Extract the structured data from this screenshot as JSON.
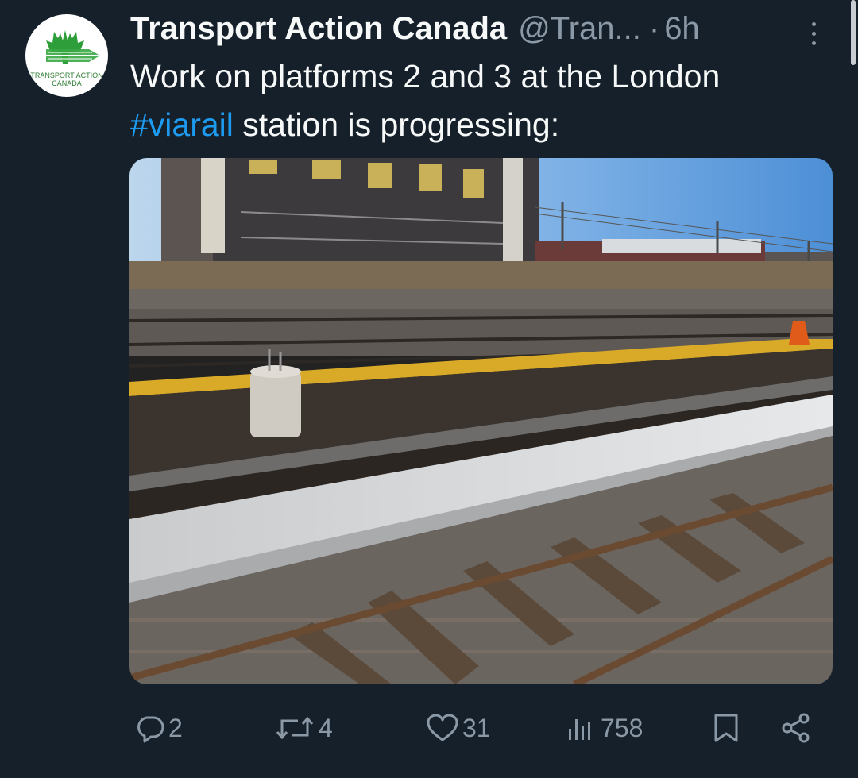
{
  "tweet": {
    "author_name": "Transport Action Canada",
    "author_handle": "@Tran...",
    "separator": "·",
    "timestamp": "6h",
    "avatar_logo_text": "TRANSPORT ACTION CANADA",
    "text_before": "Work on platforms 2 and 3 at the London ",
    "hashtag": "#viarail",
    "text_after": " station is progressing:",
    "media_icon": "photo-railway-platform"
  },
  "actions": {
    "replies": {
      "icon": "reply-icon",
      "count": "2"
    },
    "retweets": {
      "icon": "retweet-icon",
      "count": "4"
    },
    "likes": {
      "icon": "heart-icon",
      "count": "31"
    },
    "views": {
      "icon": "views-chart-icon",
      "count": "758"
    },
    "bookmark": {
      "icon": "bookmark-icon"
    },
    "share": {
      "icon": "share-icon"
    }
  },
  "colors": {
    "background": "#15202b",
    "primary_text": "#f7f9f9",
    "secondary_text": "#8b98a5",
    "link": "#1d9bf0"
  }
}
